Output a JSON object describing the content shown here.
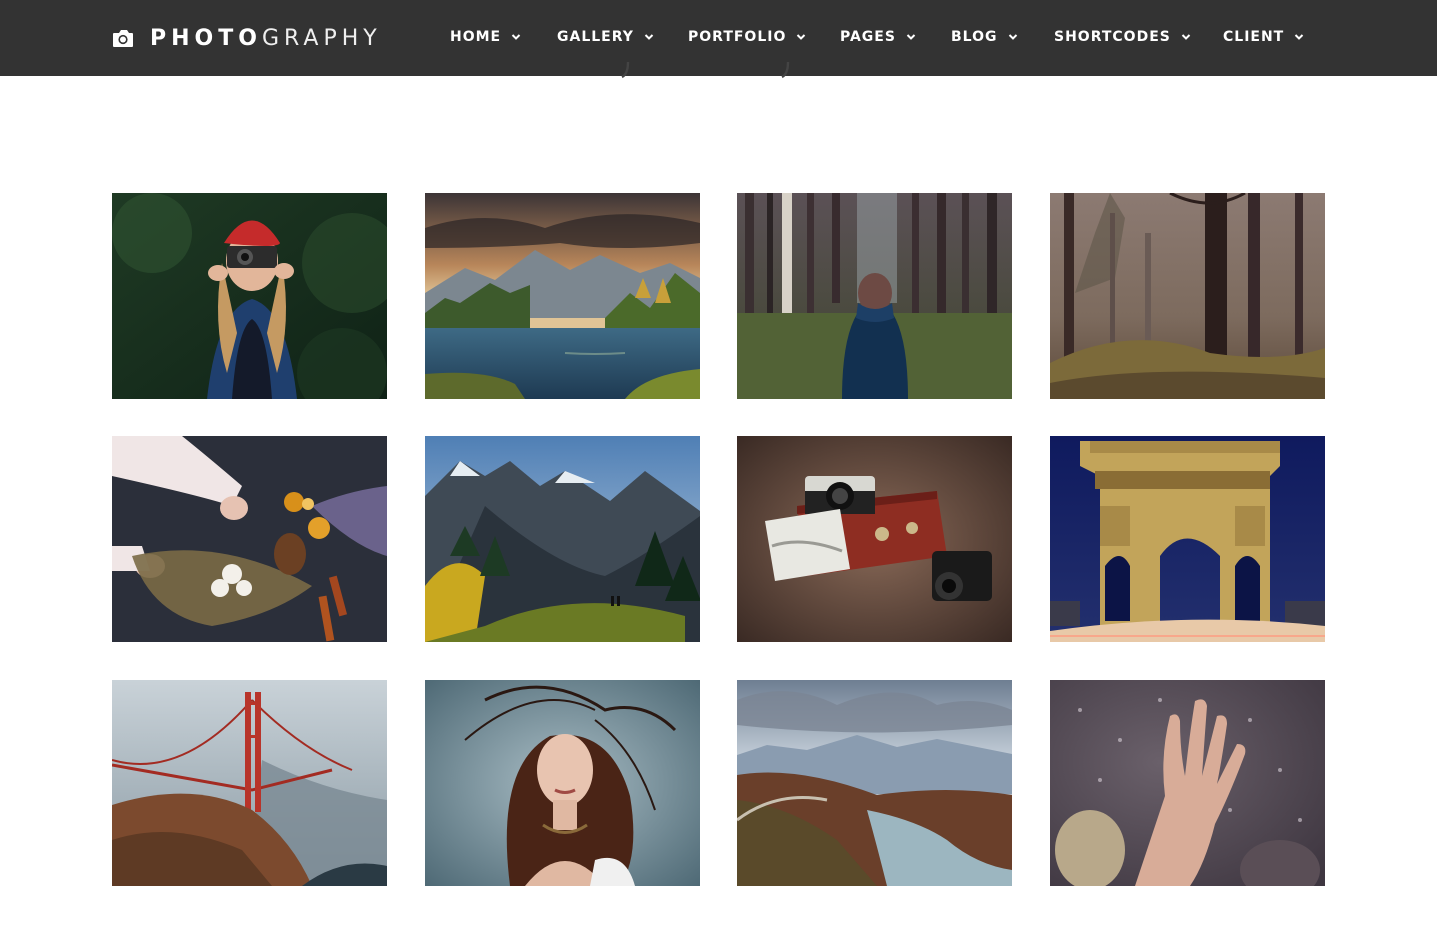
{
  "header": {
    "logo": {
      "bold": "PHOTO",
      "thin": "GRAPHY",
      "icon": "camera-icon"
    },
    "menu": [
      {
        "label": "HOME"
      },
      {
        "label": "GALLERY"
      },
      {
        "label": "PORTFOLIO"
      },
      {
        "label": "PAGES"
      },
      {
        "label": "BLOG"
      },
      {
        "label": "SHORTCODES"
      },
      {
        "label": "CLIENT"
      }
    ]
  },
  "gallery": {
    "items": [
      {
        "subject": "woman-with-camera-in-forest"
      },
      {
        "subject": "mountain-lake-sunset"
      },
      {
        "subject": "person-in-pine-forest"
      },
      {
        "subject": "misty-forest-trees"
      },
      {
        "subject": "dried-flowers-flatlay"
      },
      {
        "subject": "mountain-valley-hikers"
      },
      {
        "subject": "vintage-cameras-suitcase"
      },
      {
        "subject": "arc-de-triomphe-night"
      },
      {
        "subject": "golden-gate-bridge-fog"
      },
      {
        "subject": "woman-windblown-hair"
      },
      {
        "subject": "mountain-river-valley"
      },
      {
        "subject": "hand-on-rainy-glass"
      }
    ]
  },
  "colors": {
    "navbar": "#333333",
    "text": "#ffffff",
    "background": "#ffffff"
  }
}
